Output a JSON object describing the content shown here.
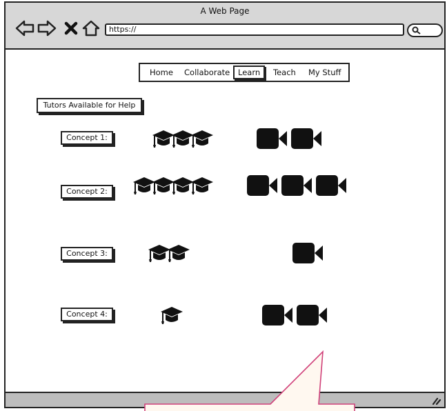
{
  "window": {
    "title": "A Web Page"
  },
  "browser": {
    "url": "https://",
    "icons": [
      "back-arrow-icon",
      "forward-arrow-icon",
      "close-x-icon",
      "home-icon",
      "search-icon"
    ]
  },
  "nav": {
    "items": [
      {
        "label": "Home"
      },
      {
        "label": "Collaborate"
      },
      {
        "label": "Learn",
        "active": true
      },
      {
        "label": "Teach"
      },
      {
        "label": "My Stuff"
      }
    ]
  },
  "section_button": "Tutors Available for Help",
  "concepts": [
    {
      "label": "Concept 1:",
      "tutor_caps": 3,
      "video_cams": 2
    },
    {
      "label": "Concept 2:",
      "tutor_caps": 4,
      "video_cams": 3
    },
    {
      "label": "Concept 3:",
      "tutor_caps": 2,
      "video_cams": 1
    },
    {
      "label": "Concept 4:",
      "tutor_caps": 1,
      "video_cams": 2
    }
  ],
  "colors": {
    "chrome": "#d7d7d7",
    "footer": "#bdbdbd",
    "callout_border": "#d0417a",
    "callout_fill": "#fff8f0"
  }
}
